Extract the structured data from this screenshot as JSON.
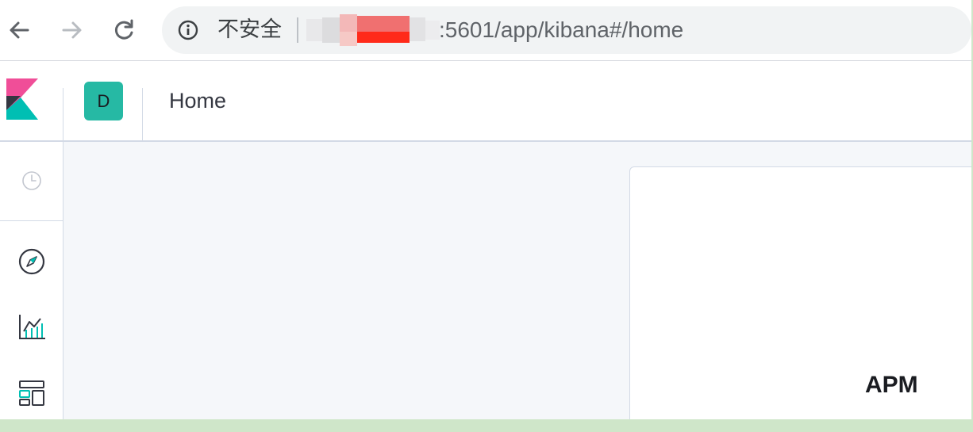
{
  "browser": {
    "back_icon": "arrow-left-icon",
    "forward_icon": "arrow-right-icon",
    "reload_icon": "reload-icon",
    "info_icon": "info-icon",
    "security_label": "不安全",
    "url_visible": ":5601/app/kibana#/home"
  },
  "header": {
    "space_initial": "D",
    "breadcrumb": "Home",
    "space_color": "#26b9a4"
  },
  "side_nav": {
    "items": [
      {
        "icon": "clock-icon"
      },
      {
        "icon": "compass-icon"
      },
      {
        "icon": "visualize-icon"
      },
      {
        "icon": "dashboard-icon"
      }
    ]
  },
  "main": {
    "card_title": "APM"
  },
  "colors": {
    "kibana_pink": "#f04e98",
    "kibana_teal": "#00bfb3",
    "kibana_dark": "#343741",
    "page_bg": "#f5f7fa",
    "bottom_strip": "#cfe6c9"
  }
}
